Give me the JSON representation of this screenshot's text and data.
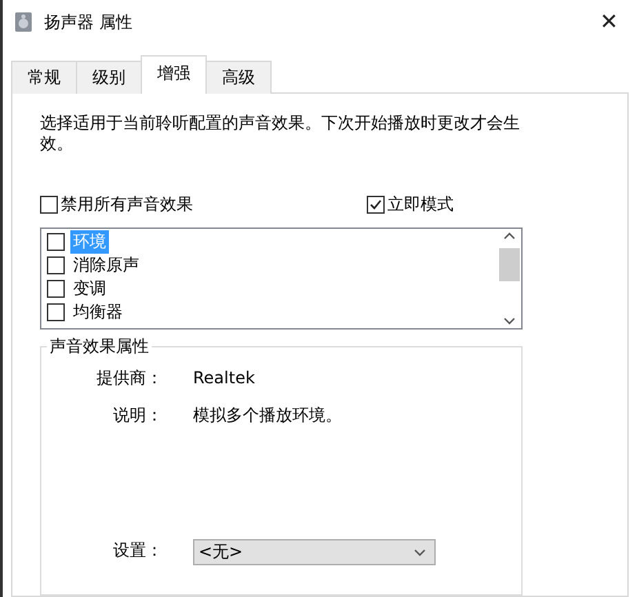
{
  "window": {
    "title": "扬声器 属性",
    "close": "✕"
  },
  "tabs": [
    {
      "label": "常规",
      "selected": false
    },
    {
      "label": "级别",
      "selected": false
    },
    {
      "label": "增强",
      "selected": true
    },
    {
      "label": "高级",
      "selected": false
    }
  ],
  "description": "选择适用于当前聆听配置的声音效果。下次开始播放时更改才会生效。",
  "options": [
    {
      "label": "禁用所有声音效果",
      "checked": false
    },
    {
      "label": "立即模式",
      "checked": true
    }
  ],
  "effects": [
    {
      "label": "环境",
      "checked": false,
      "selected": true
    },
    {
      "label": "消除原声",
      "checked": false,
      "selected": false
    },
    {
      "label": "变调",
      "checked": false,
      "selected": false
    },
    {
      "label": "均衡器",
      "checked": false,
      "selected": false
    }
  ],
  "properties": {
    "title": "声音效果属性",
    "provider_label": "提供商：",
    "provider": "Realtek",
    "description_label": "说明：",
    "description": "模拟多个播放环境。",
    "setting_label": "设置：",
    "setting": "<无>"
  }
}
